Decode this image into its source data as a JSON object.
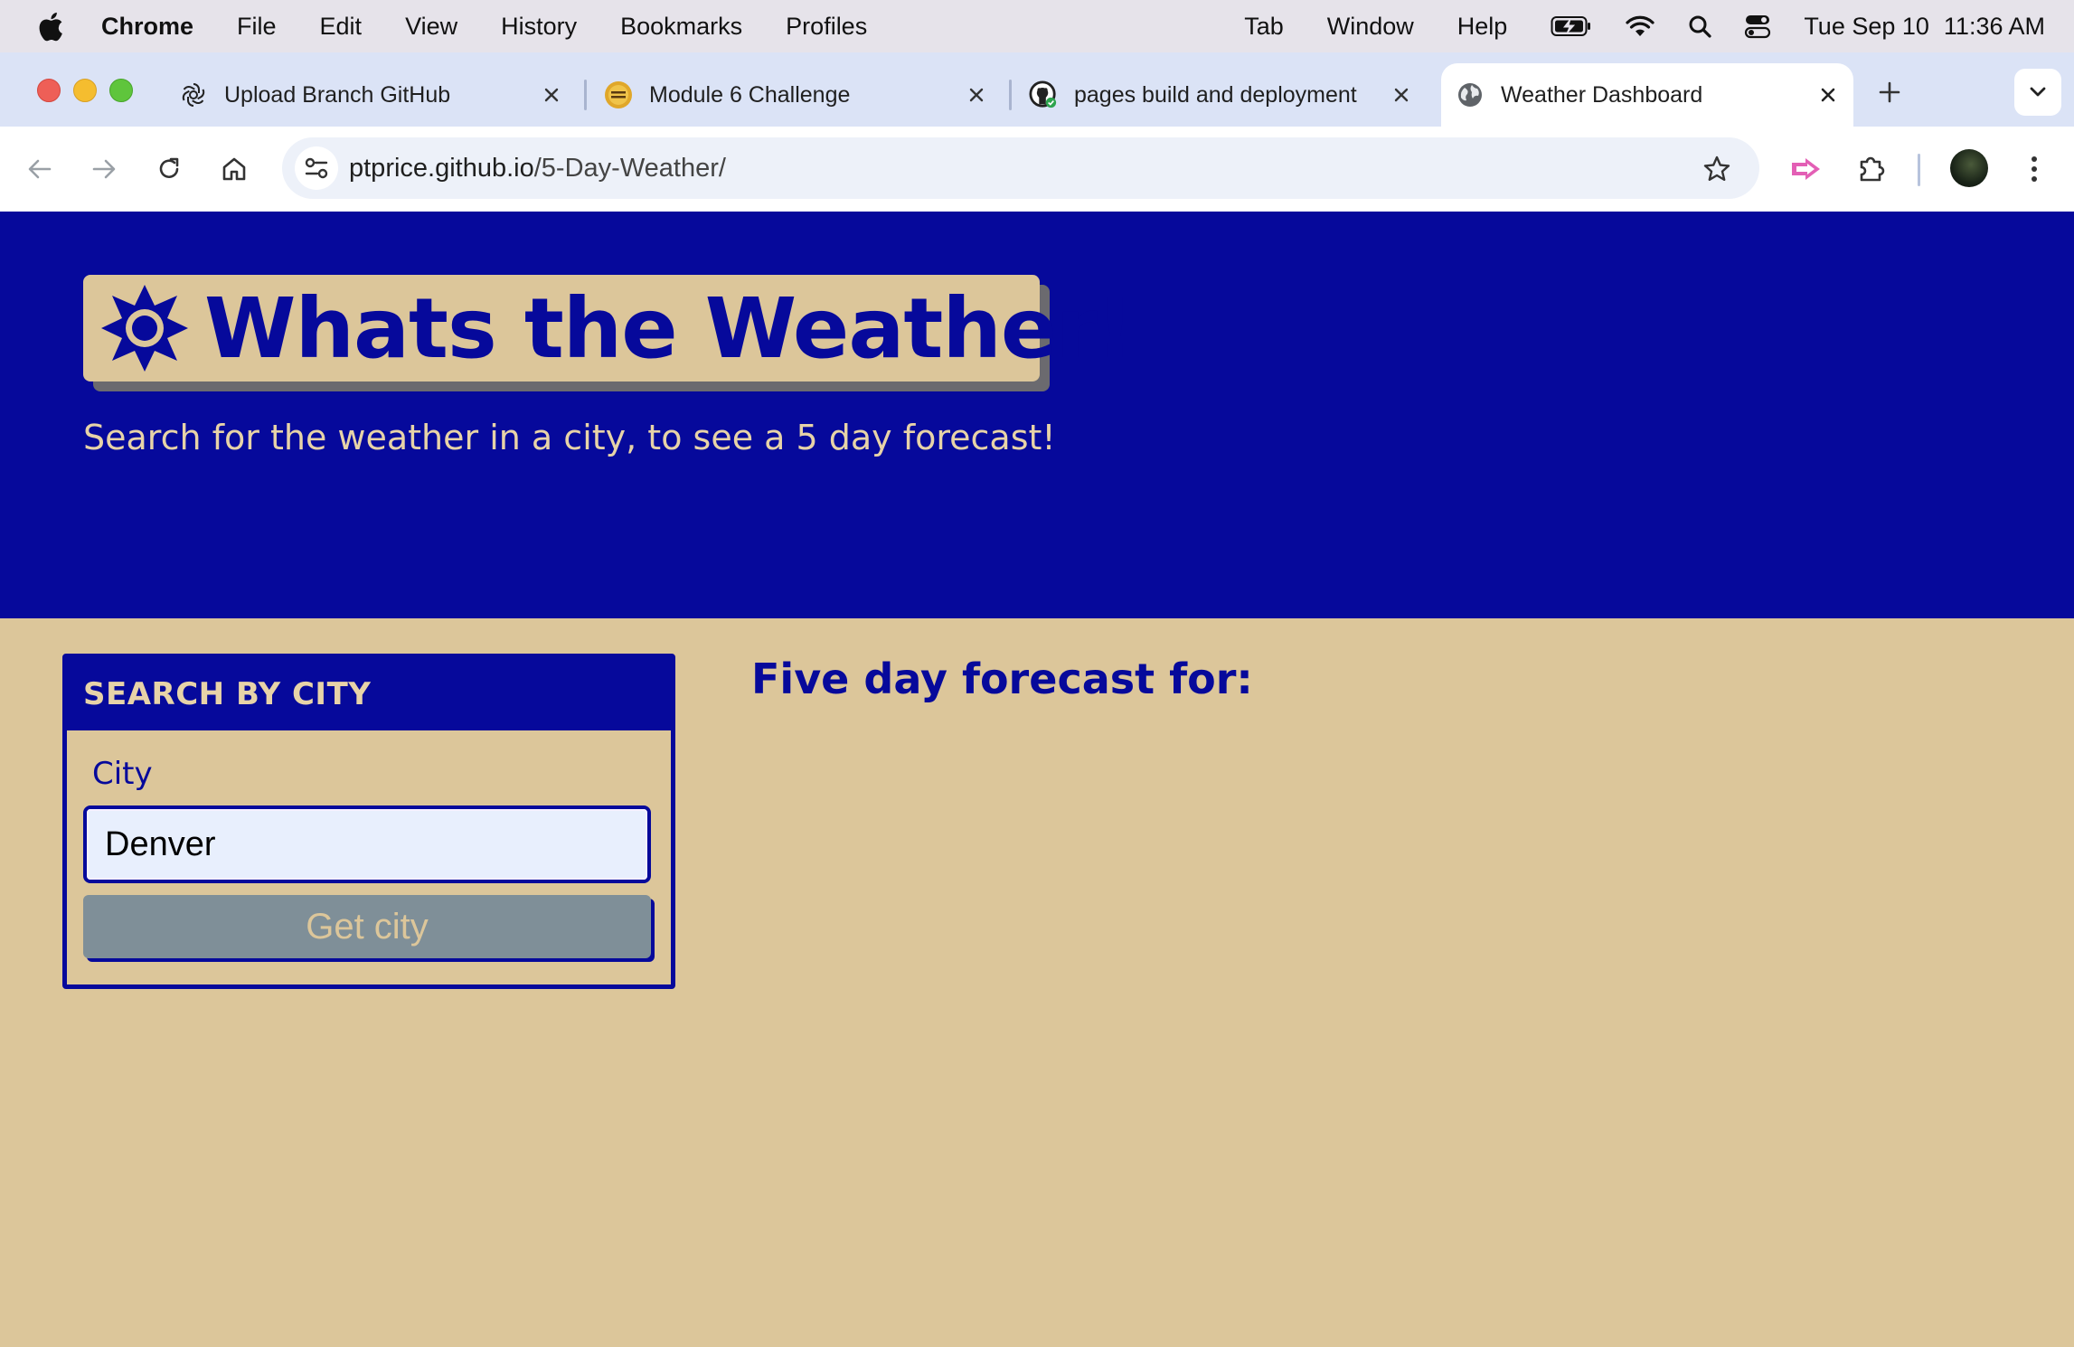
{
  "menubar": {
    "app_name": "Chrome",
    "menus": [
      "File",
      "Edit",
      "View",
      "History",
      "Bookmarks",
      "Profiles"
    ],
    "right_menus": [
      "Tab",
      "Window",
      "Help"
    ],
    "date": "Tue Sep 10",
    "time": "11:36 AM"
  },
  "tabs": [
    {
      "title": "Upload Branch GitHub",
      "icon": "chatgpt-icon"
    },
    {
      "title": "Module 6 Challenge",
      "icon": "module-icon"
    },
    {
      "title": "pages build and deployment",
      "icon": "github-icon"
    },
    {
      "title": "Weather Dashboard",
      "icon": "globe-icon",
      "active": true
    }
  ],
  "address_bar": {
    "domain": "ptprice.github.io",
    "path": "/5-Day-Weather/"
  },
  "page": {
    "title": "Whats the Weather!",
    "subtitle": "Search for the weather in a city, to see a 5 day forecast!",
    "search_heading": "SEARCH BY CITY",
    "city_label": "City",
    "city_value": "Denver",
    "button_label": "Get city",
    "forecast_heading": "Five day forecast for:"
  },
  "colors": {
    "brand_blue": "#06099b",
    "tan": "#dcc69a",
    "button_gray": "#7f8f98"
  }
}
